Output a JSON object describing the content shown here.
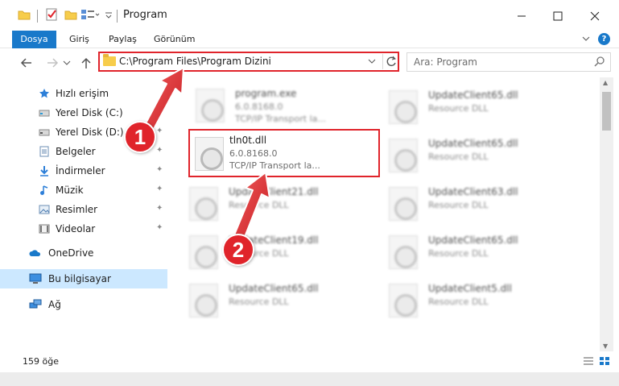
{
  "window": {
    "title": "Program"
  },
  "ribbon": {
    "tabs": [
      {
        "label": "Dosya"
      },
      {
        "label": "Giriş"
      },
      {
        "label": "Paylaş"
      },
      {
        "label": "Görünüm"
      }
    ],
    "help": "?"
  },
  "address": {
    "path": "C:\\Program Files\\Program Dizini"
  },
  "search": {
    "placeholder": "Ara: Program"
  },
  "sidebar": {
    "items": [
      {
        "label": "Hızlı erişim",
        "icon": "star-icon"
      },
      {
        "label": "Yerel Disk (C:)",
        "icon": "drive-icon"
      },
      {
        "label": "Yerel Disk (D:)",
        "icon": "drive-icon"
      },
      {
        "label": "Belgeler",
        "icon": "documents-icon"
      },
      {
        "label": "İndirmeler",
        "icon": "download-icon"
      },
      {
        "label": "Müzik",
        "icon": "music-icon"
      },
      {
        "label": "Resimler",
        "icon": "pictures-icon"
      },
      {
        "label": "Videolar",
        "icon": "videos-icon"
      },
      {
        "label": "OneDrive",
        "icon": "cloud-icon"
      },
      {
        "label": "Bu bilgisayar",
        "icon": "computer-icon"
      },
      {
        "label": "Ağ",
        "icon": "network-icon"
      }
    ]
  },
  "files": {
    "left": [
      {
        "name": "program.exe",
        "line1": "6.0.8168.0",
        "line2": "TCP/IP Transport la..."
      },
      {
        "name": "tln0t.dll",
        "line1": "6.0.8168.0",
        "line2": "TCP/IP Transport la..."
      },
      {
        "name": "UpdateClient21.dll",
        "line1": "Resource DLL",
        "line2": ""
      },
      {
        "name": "UpdateClient19.dll",
        "line1": "Resource DLL",
        "line2": ""
      },
      {
        "name": "UpdateClient65.dll",
        "line1": "Resource DLL",
        "line2": ""
      }
    ],
    "right": [
      {
        "name": "UpdateClient65.dll",
        "line1": "Resource DLL"
      },
      {
        "name": "UpdateClient65.dll",
        "line1": "Resource DLL"
      },
      {
        "name": "UpdateClient63.dll",
        "line1": "Resource DLL"
      },
      {
        "name": "UpdateClient65.dll",
        "line1": "Resource DLL"
      },
      {
        "name": "UpdateClient5.dll",
        "line1": "Resource DLL"
      }
    ]
  },
  "status": {
    "item_count": "159 öğe"
  },
  "annotations": {
    "step1": "1",
    "step2": "2"
  },
  "colors": {
    "accent": "#1979ca",
    "highlight": "#e0242b",
    "selected": "#cce8ff"
  }
}
